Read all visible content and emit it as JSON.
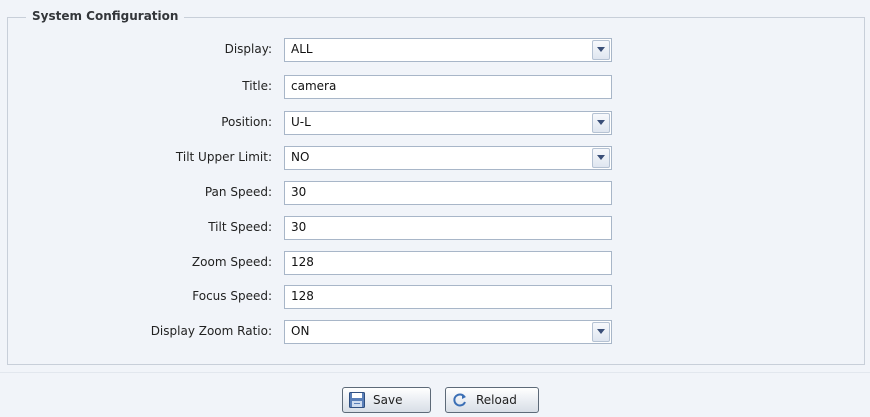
{
  "section": {
    "title": "System Configuration"
  },
  "fields": [
    {
      "label": "Display:",
      "value": "ALL",
      "type": "select"
    },
    {
      "label": "Title:",
      "value": "camera",
      "type": "text"
    },
    {
      "label": "Position:",
      "value": "U-L",
      "type": "select"
    },
    {
      "label": "Tilt Upper Limit:",
      "value": "NO",
      "type": "select"
    },
    {
      "label": "Pan Speed:",
      "value": "30",
      "type": "text"
    },
    {
      "label": "Tilt Speed:",
      "value": "30",
      "type": "text"
    },
    {
      "label": "Zoom Speed:",
      "value": "128",
      "type": "text"
    },
    {
      "label": "Focus Speed:",
      "value": "128",
      "type": "text"
    },
    {
      "label": "Display Zoom Ratio:",
      "value": "ON",
      "type": "select"
    }
  ],
  "buttons": {
    "save_label": "Save",
    "save_icon": "floppy-disk-icon",
    "reload_label": "Reload",
    "reload_icon": "refresh-icon"
  },
  "colors": {
    "background": "#f1f4f9",
    "border": "#c8cfd9",
    "field_border": "#a8b6c8"
  }
}
